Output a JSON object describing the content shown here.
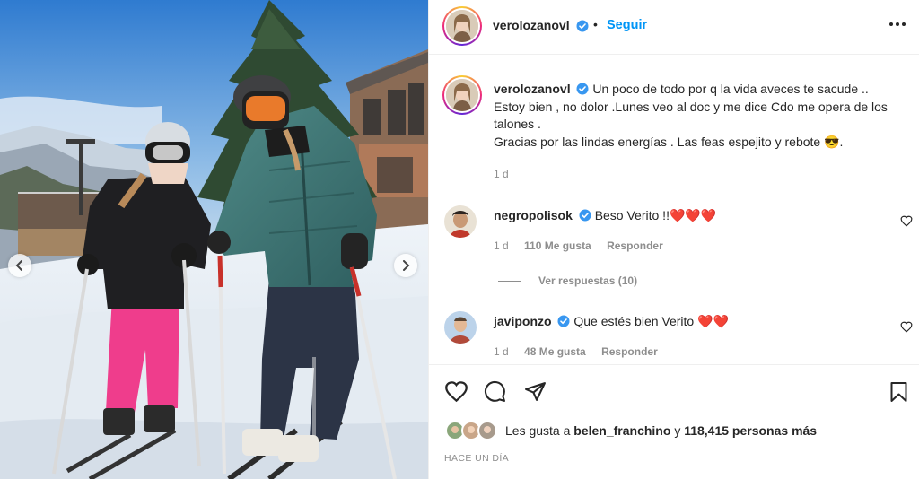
{
  "post": {
    "author": "verolozanovl",
    "follow_label": "Seguir",
    "more_icon": "more-horizontal-icon"
  },
  "caption": {
    "author": "verolozanovl",
    "text": "Un poco de todo por q la vida aveces te sacude ..\nEstoy bien , no dolor .Lunes veo al doc y me dice Cdo me opera de los talones .\nGracias por las lindas energías . Las feas espejito y rebote 😎.",
    "time": "1 d"
  },
  "comments": [
    {
      "username": "negropolisok",
      "text": "Beso Verito !!❤️❤️❤️",
      "time": "1 d",
      "likes": "110 Me gusta",
      "reply_label": "Responder",
      "view_replies": "Ver respuestas (10)"
    },
    {
      "username": "javiponzo",
      "text": "Que estés bien Verito ❤️❤️",
      "time": "1 d",
      "likes": "48 Me gusta",
      "reply_label": "Responder"
    }
  ],
  "likes_summary": {
    "prefix": "Les gusta a",
    "user": "belen_franchino",
    "middle": "y",
    "count": "118,415 personas más"
  },
  "posted_ago": "HACE UN DÍA",
  "colors": {
    "accent": "#0095f6",
    "verified": "#3897f0",
    "muted": "#8e8e8e",
    "text": "#262626",
    "heart": "#e0245e"
  }
}
